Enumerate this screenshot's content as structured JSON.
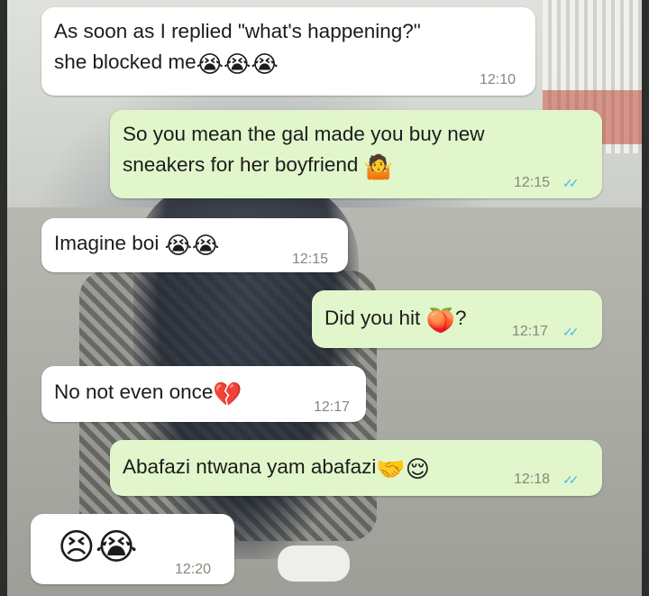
{
  "messages": [
    {
      "direction": "incoming",
      "line1": "As soon as I replied \"what's happening?\"",
      "line2": "she blocked me",
      "emoji": "😭😭😭",
      "time": "12:10"
    },
    {
      "direction": "outgoing",
      "line1": "So you mean the gal made you buy  new",
      "line2": "sneakers for her boyfriend",
      "emoji": "🤷",
      "time": "12:15",
      "status": "read"
    },
    {
      "direction": "incoming",
      "text": "Imagine  boi",
      "emoji": "😭😭",
      "time": "12:15"
    },
    {
      "direction": "outgoing",
      "text": "Did you hit",
      "emoji": "🍑",
      "suffix": "?",
      "time": "12:17",
      "status": "read"
    },
    {
      "direction": "incoming",
      "text": "No not even once",
      "emoji": "💔",
      "time": "12:17"
    },
    {
      "direction": "outgoing",
      "text": "Abafazi ntwana yam abafazi",
      "emoji": "🤝😌",
      "time": "12:18",
      "status": "read"
    },
    {
      "direction": "incoming",
      "text": "",
      "emoji": "😣😭",
      "time": "12:20"
    }
  ],
  "read_ticks": "✓✓",
  "colors": {
    "incoming": "#ffffff",
    "outgoing": "#e1f6cb",
    "ticks": "#4fb6ec",
    "timestamp": "#7f8a7b"
  }
}
